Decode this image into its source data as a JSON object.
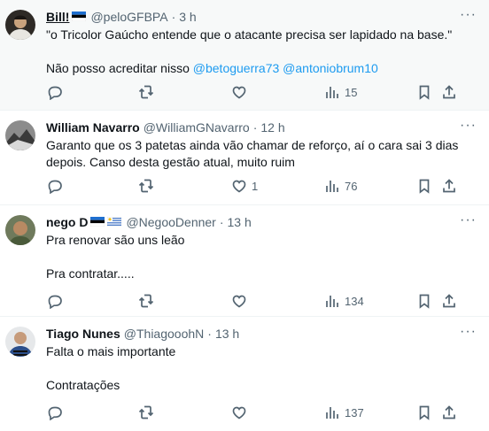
{
  "tweets": [
    {
      "name": "Bill!",
      "handle": "@peloGFBPA",
      "time": "3 h",
      "text": "\"o Tricolor Gaúcho entende que o atacante precisa ser lapidado na base.\"\n\nNão posso acreditar nisso ",
      "mention1": "@betoguerra73",
      "mention2": "@antoniobrum10",
      "replies": "",
      "retweets": "",
      "likes": "",
      "views": "15"
    },
    {
      "name": "William Navarro",
      "handle": "@WilliamGNavarro",
      "time": "12 h",
      "text": "Garanto que os 3 patetas ainda vão chamar de reforço, aí o cara sai 3 dias depois.  Canso desta gestão atual, muito ruim",
      "replies": "",
      "retweets": "",
      "likes": "1",
      "views": "76"
    },
    {
      "name": "nego D",
      "handle": "@NegooDenner",
      "time": "13 h",
      "text": "Pra renovar são uns leão\n\nPra contratar.....",
      "replies": "",
      "retweets": "",
      "likes": "",
      "views": "134"
    },
    {
      "name": "Tiago Nunes",
      "handle": "@ThiagooohN",
      "time": "13 h",
      "text": "Falta o mais importante\n\nContratações",
      "replies": "",
      "retweets": "",
      "likes": "",
      "views": "137"
    }
  ],
  "more_glyph": "···",
  "dot": "·",
  "colors": {
    "accent": "#1d9bf0",
    "muted": "#536471",
    "highlight_bg": "#f7f9f9"
  },
  "icons": [
    "reply-icon",
    "retweet-icon",
    "like-icon",
    "views-icon",
    "bookmark-icon",
    "share-icon",
    "more-icon"
  ]
}
